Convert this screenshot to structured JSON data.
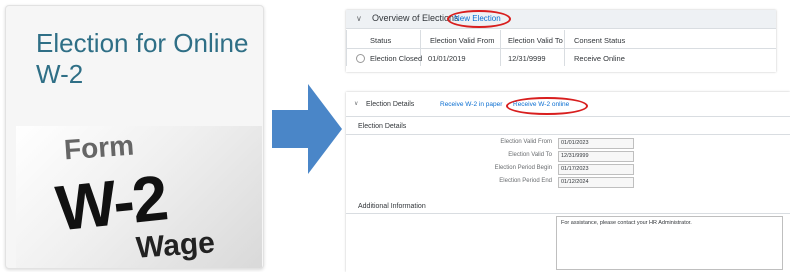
{
  "tile": {
    "title": "Election for Online W-2",
    "image_words": {
      "form": "Form",
      "w2": "W-2",
      "wage": "Wage"
    }
  },
  "overview": {
    "title": "Overview of Elections",
    "new_election": "New Election",
    "columns": [
      "Status",
      "Election Valid From",
      "Election Valid To",
      "Consent Status"
    ],
    "rows": [
      {
        "status": "Election Closed",
        "valid_from": "01/01/2019",
        "valid_to": "12/31/9999",
        "consent": "Receive Online"
      }
    ]
  },
  "details": {
    "title": "Election Details",
    "link_paper": "Receive W-2 in paper",
    "link_online": "Receive W-2 online",
    "section_title": "Election Details",
    "fields": [
      {
        "label": "Election Valid From",
        "value": "01/01/2023"
      },
      {
        "label": "Election Valid To",
        "value": "12/31/9999"
      },
      {
        "label": "Election Period Begin",
        "value": "01/17/2023"
      },
      {
        "label": "Election Period End",
        "value": "01/12/2024"
      }
    ],
    "additional_title": "Additional Information",
    "additional_text": "For assistance, please contact your HR Administrator."
  },
  "colors": {
    "accent": "#0a6ed1",
    "highlight": "#d81e1e",
    "title": "#2f6f86",
    "arrow": "#4a86c8"
  }
}
